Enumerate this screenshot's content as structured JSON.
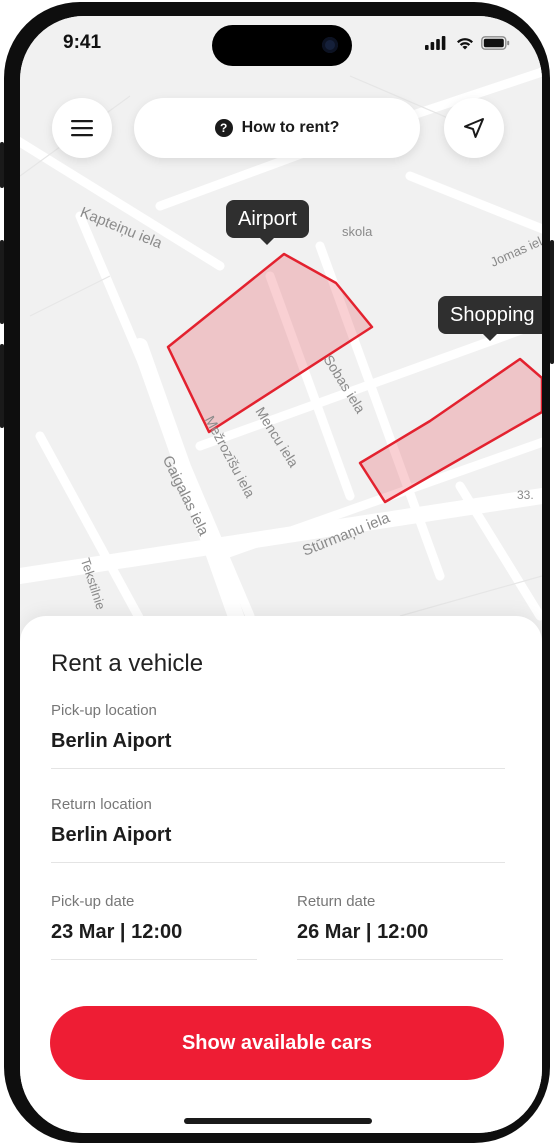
{
  "status_bar": {
    "time": "9:41"
  },
  "top_bar": {
    "menu_icon": "hamburger-menu-icon",
    "how_to_rent_label": "How to rent?",
    "help_icon": "question-circle-icon",
    "location_icon": "navigation-arrow-icon"
  },
  "map": {
    "streets": [
      "Kapteiņu iela",
      "skola",
      "Jomas iel",
      "Mencu iela",
      "Sobas iela",
      "Mežrozīšu iela",
      "Gaigalas iela",
      "Stūrmaņu iela",
      "Tekstilnie",
      "33."
    ],
    "zones": [
      "Airport",
      "Shopping"
    ],
    "zone_color": "#e3222f"
  },
  "sheet": {
    "title": "Rent a vehicle",
    "pickup_location": {
      "label": "Pick-up location",
      "value": "Berlin Aiport"
    },
    "return_location": {
      "label": "Return location",
      "value": "Berlin Aiport"
    },
    "pickup_date": {
      "label": "Pick-up date",
      "value": "23 Mar | 12:00"
    },
    "return_date": {
      "label": "Return date",
      "value": "26 Mar | 12:00"
    },
    "cta_label": "Show available cars",
    "accent_color": "#ee1d34"
  }
}
